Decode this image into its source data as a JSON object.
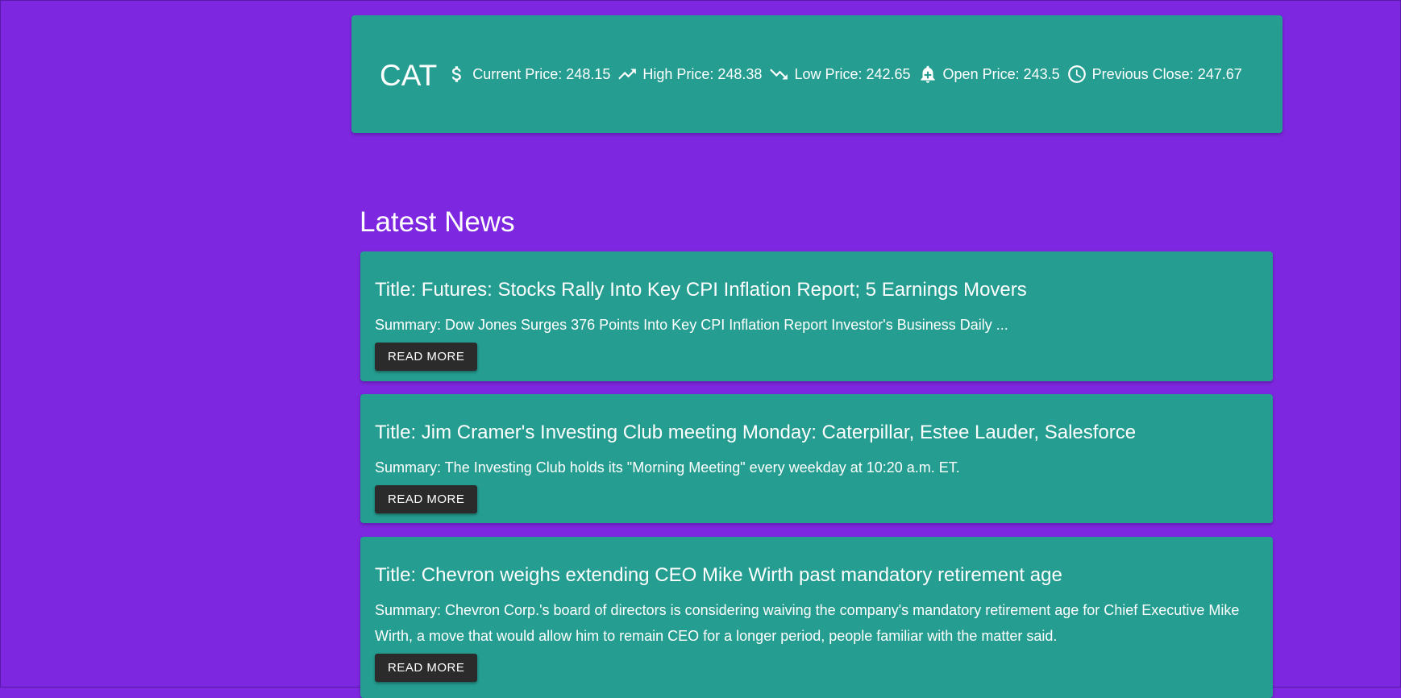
{
  "stock": {
    "ticker": "CAT",
    "current_price": "Current Price: 248.15",
    "high_price": "High Price: 248.38",
    "low_price": "Low Price: 242.65",
    "open_price": "Open Price: 243.5",
    "previous_close": "Previous Close: 247.67"
  },
  "news": {
    "heading": "Latest News",
    "items": [
      {
        "title": "Title: Futures: Stocks Rally Into Key CPI Inflation Report; 5 Earnings Movers",
        "summary": "Summary: Dow Jones Surges 376 Points Into Key CPI Inflation Report Investor's Business Daily ...",
        "button": "READ MORE"
      },
      {
        "title": "Title: Jim Cramer's Investing Club meeting Monday: Caterpillar, Estee Lauder, Salesforce",
        "summary": "Summary: The Investing Club holds its \"Morning Meeting\" every weekday at 10:20 a.m. ET.",
        "button": "READ MORE"
      },
      {
        "title": "Title: Chevron weighs extending CEO Mike Wirth past mandatory retirement age",
        "summary": "Summary: Chevron Corp.'s board of directors is considering waiving the company's mandatory retirement age for Chief Executive Mike Wirth, a move that would allow him to remain CEO for a longer period, people familiar with the matter said.",
        "button": "READ MORE"
      }
    ]
  },
  "colors": {
    "background": "#7e27e0",
    "card": "#259d91",
    "button": "#2b2b2b",
    "text": "#ffffff"
  },
  "icons": {
    "current_price": "dollar-icon",
    "high_price": "trending-up-icon",
    "low_price": "trending-down-icon",
    "open_price": "bell-plus-icon",
    "previous_close": "clock-icon"
  }
}
